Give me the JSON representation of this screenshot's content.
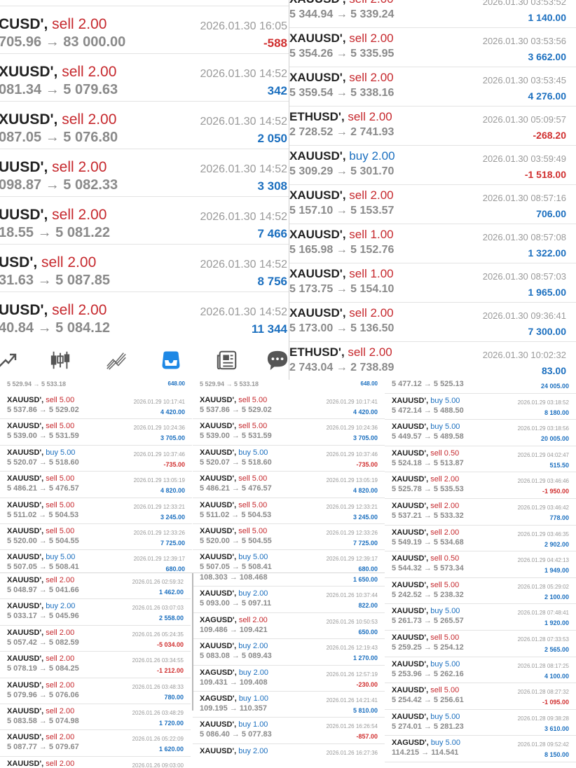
{
  "top_left_panel": {
    "rows": [
      {
        "symbol": "CUSD'",
        "side": "sell",
        "volume": "2.00",
        "prices": "705.96 → 83 000.00",
        "datetime": "2026.01.30 16:05",
        "profit": "-588"
      },
      {
        "symbol": "XUUSD'",
        "side": "sell",
        "volume": "2.00",
        "prices": "081.34 → 5 079.63",
        "datetime": "2026.01.30 14:52",
        "profit": "342"
      },
      {
        "symbol": "XUUSD'",
        "side": "sell",
        "volume": "2.00",
        "prices": "087.05 → 5 076.80",
        "datetime": "2026.01.30 14:52",
        "profit": "2 050"
      },
      {
        "symbol": "UUSD'",
        "side": "sell",
        "volume": "2.00",
        "prices": "098.87 → 5 082.33",
        "datetime": "2026.01.30 14:52",
        "profit": "3 308"
      },
      {
        "symbol": "UUSD'",
        "side": "sell",
        "volume": "2.00",
        "prices": "18.55 → 5 081.22",
        "datetime": "2026.01.30 14:52",
        "profit": "7 466"
      },
      {
        "symbol": "USD'",
        "side": "sell",
        "volume": "2.00",
        "prices": "31.63 → 5 087.85",
        "datetime": "2026.01.30 14:52",
        "profit": "8 756"
      },
      {
        "symbol": "UUSD'",
        "side": "sell",
        "volume": "2.00",
        "prices": "40.84 → 5 084.12",
        "datetime": "2026.01.30 14:52",
        "profit": "11 344"
      }
    ]
  },
  "toolbar": {
    "icons": [
      "trade-icon",
      "candlestick-icon",
      "chart-line-icon",
      "history-inbox-icon",
      "news-icon",
      "chat-icon"
    ],
    "active_color": "#1e88e5"
  },
  "top_right_panel": {
    "rows": [
      {
        "symbol": "XAUUSD'",
        "side": "sell",
        "volume": "2.00",
        "prices": "5 344.94 → 5 339.24",
        "datetime": "2026.01.30 03:53:52",
        "profit": "1 140.00"
      },
      {
        "symbol": "XAUUSD'",
        "side": "sell",
        "volume": "2.00",
        "prices": "5 354.26 → 5 335.95",
        "datetime": "2026.01.30 03:53:56",
        "profit": "3 662.00"
      },
      {
        "symbol": "XAUUSD'",
        "side": "sell",
        "volume": "2.00",
        "prices": "5 359.54 → 5 338.16",
        "datetime": "2026.01.30 03:53:45",
        "profit": "4 276.00"
      },
      {
        "symbol": "ETHUSD'",
        "side": "sell",
        "volume": "2.00",
        "prices": "2 728.52 → 2 741.93",
        "datetime": "2026.01.30 05:09:57",
        "profit": "-268.20"
      },
      {
        "symbol": "XAUUSD'",
        "side": "buy",
        "volume": "2.00",
        "prices": "5 309.29 → 5 301.70",
        "datetime": "2026.01.30 03:59:49",
        "profit": "-1 518.00"
      },
      {
        "symbol": "XAUUSD'",
        "side": "sell",
        "volume": "2.00",
        "prices": "5 157.10 → 5 153.57",
        "datetime": "2026.01.30 08:57:16",
        "profit": "706.00"
      },
      {
        "symbol": "XAUUSD'",
        "side": "sell",
        "volume": "1.00",
        "prices": "5 165.98 → 5 152.76",
        "datetime": "2026.01.30 08:57:08",
        "profit": "1 322.00"
      },
      {
        "symbol": "XAUUSD'",
        "side": "sell",
        "volume": "1.00",
        "prices": "5 173.75 → 5 154.10",
        "datetime": "2026.01.30 08:57:03",
        "profit": "1 965.00"
      },
      {
        "symbol": "XAUUSD'",
        "side": "sell",
        "volume": "2.00",
        "prices": "5 173.00 → 5 136.50",
        "datetime": "2026.01.30 09:36:41",
        "profit": "7 300.00"
      },
      {
        "symbol": "ETHUSD'",
        "side": "sell",
        "volume": "2.00",
        "prices": "2 743.04 → 2 738.89",
        "datetime": "2026.01.30 10:02:32",
        "profit": "83.00"
      }
    ]
  },
  "mid_left_panel": {
    "rows": [
      {
        "symbol": "XAUUSD'",
        "side": "sell",
        "volume": "5.00",
        "prices": "5 537.86 → 5 529.02",
        "datetime": "2026.01.29 10:17:41",
        "profit": "4 420.00"
      },
      {
        "symbol": "XAUUSD'",
        "side": "sell",
        "volume": "5.00",
        "prices": "5 539.00 → 5 531.59",
        "datetime": "2026.01.29 10:24:36",
        "profit": "3 705.00"
      },
      {
        "symbol": "XAUUSD'",
        "side": "buy",
        "volume": "5.00",
        "prices": "5 520.07 → 5 518.60",
        "datetime": "2026.01.29 10:37:46",
        "profit": "-735.00"
      },
      {
        "symbol": "XAUUSD'",
        "side": "sell",
        "volume": "5.00",
        "prices": "5 486.21 → 5 476.57",
        "datetime": "2026.01.29 13:05:19",
        "profit": "4 820.00"
      },
      {
        "symbol": "XAUUSD'",
        "side": "sell",
        "volume": "5.00",
        "prices": "5 511.02 → 5 504.53",
        "datetime": "2026.01.29 12:33:21",
        "profit": "3 245.00"
      },
      {
        "symbol": "XAUUSD'",
        "side": "sell",
        "volume": "5.00",
        "prices": "5 520.00 → 5 504.55",
        "datetime": "2026.01.29 12:33:26",
        "profit": "7 725.00"
      },
      {
        "symbol": "XAUUSD'",
        "side": "buy",
        "volume": "5.00",
        "prices": "5 507.05 → 5 508.41",
        "datetime": "2026.01.29 12:39:17",
        "profit": "680.00"
      }
    ]
  },
  "mid_center_panel": {
    "rows": [
      {
        "symbol": "XAUUSD'",
        "side": "sell",
        "volume": "5.00",
        "prices": "5 537.86 → 5 529.02",
        "datetime": "2026.01.29 10:17:41",
        "profit": "4 420.00"
      },
      {
        "symbol": "XAUUSD'",
        "side": "sell",
        "volume": "5.00",
        "prices": "5 539.00 → 5 531.59",
        "datetime": "2026.01.29 10:24:36",
        "profit": "3 705.00"
      },
      {
        "symbol": "XAUUSD'",
        "side": "buy",
        "volume": "5.00",
        "prices": "5 520.07 → 5 518.60",
        "datetime": "2026.01.29 10:37:46",
        "profit": "-735.00"
      },
      {
        "symbol": "XAUUSD'",
        "side": "sell",
        "volume": "5.00",
        "prices": "5 486.21 → 5 476.57",
        "datetime": "2026.01.29 13:05:19",
        "profit": "4 820.00"
      },
      {
        "symbol": "XAUUSD'",
        "side": "sell",
        "volume": "5.00",
        "prices": "5 511.02 → 5 504.53",
        "datetime": "2026.01.29 12:33:21",
        "profit": "3 245.00"
      },
      {
        "symbol": "XAUUSD'",
        "side": "sell",
        "volume": "5.00",
        "prices": "5 520.00 → 5 504.55",
        "datetime": "2026.01.29 12:33:26",
        "profit": "7 725.00"
      },
      {
        "symbol": "XAUUSD'",
        "side": "buy",
        "volume": "5.00",
        "prices": "5 507.05 → 5 508.41",
        "datetime": "2026.01.29 12:39:17",
        "profit": "680.00"
      }
    ]
  },
  "right_panel": {
    "rows": [
      {
        "symbol": "",
        "side": "",
        "volume": "",
        "prices": "5 477.12 → 5 525.13",
        "datetime": "",
        "profit": "24 005.00"
      },
      {
        "symbol": "XAUUSD'",
        "side": "buy",
        "volume": "5.00",
        "prices": "5 472.14 → 5 488.50",
        "datetime": "2026.01.29 03:18:52",
        "profit": "8 180.00"
      },
      {
        "symbol": "XAUUSD'",
        "side": "buy",
        "volume": "5.00",
        "prices": "5 449.57 → 5 489.58",
        "datetime": "2026.01.29 03:18:56",
        "profit": "20 005.00"
      },
      {
        "symbol": "XAUUSD'",
        "side": "sell",
        "volume": "0.50",
        "prices": "5 524.18 → 5 513.87",
        "datetime": "2026.01.29 04:02:47",
        "profit": "515.50"
      },
      {
        "symbol": "XAUUSD'",
        "side": "sell",
        "volume": "2.00",
        "prices": "5 525.78 → 5 535.53",
        "datetime": "2026.01.29 03:46:46",
        "profit": "-1 950.00"
      },
      {
        "symbol": "XAUUSD'",
        "side": "sell",
        "volume": "2.00",
        "prices": "5 537.21 → 5 533.32",
        "datetime": "2026.01.29 03:46:42",
        "profit": "778.00"
      },
      {
        "symbol": "XAUUSD'",
        "side": "sell",
        "volume": "2.00",
        "prices": "5 549.19 → 5 534.68",
        "datetime": "2026.01.29 03:46:35",
        "profit": "2 902.00"
      },
      {
        "symbol": "XAUUSD'",
        "side": "sell",
        "volume": "0.50",
        "prices": "5 544.32 → 5 573.34",
        "datetime": "2026.01.29 04:42:13",
        "profit": "1 949.00"
      },
      {
        "symbol": "XAUUSD'",
        "side": "sell",
        "volume": "5.00",
        "prices": "5 242.52 → 5 238.32",
        "datetime": "2026.01.28 05:29:02",
        "profit": "2 100.00"
      },
      {
        "symbol": "XAUUSD'",
        "side": "buy",
        "volume": "5.00",
        "prices": "5 261.73 → 5 265.57",
        "datetime": "2026.01.28 07:48:41",
        "profit": "1 920.00"
      },
      {
        "symbol": "XAUUSD'",
        "side": "sell",
        "volume": "5.00",
        "prices": "5 259.25 → 5 254.12",
        "datetime": "2026.01.28 07:33:53",
        "profit": "2 565.00"
      },
      {
        "symbol": "XAUUSD'",
        "side": "buy",
        "volume": "5.00",
        "prices": "5 253.96 → 5 262.16",
        "datetime": "2026.01.28 08:17:25",
        "profit": "4 100.00"
      },
      {
        "symbol": "XAUUSD'",
        "side": "sell",
        "volume": "5.00",
        "prices": "5 254.42 → 5 256.61",
        "datetime": "2026.01.28 08:27:32",
        "profit": "-1 095.00"
      },
      {
        "symbol": "XAUUSD'",
        "side": "buy",
        "volume": "5.00",
        "prices": "5 274.01 → 5 281.23",
        "datetime": "2026.01.28 09:38:28",
        "profit": "3 610.00"
      },
      {
        "symbol": "XAGUSD'",
        "side": "buy",
        "volume": "5.00",
        "prices": "114.215 → 114.541",
        "datetime": "2026.01.28 09:52:42",
        "profit": "8 150.00"
      }
    ]
  },
  "bottom_left_panel": {
    "rows": [
      {
        "symbol": "XAUUSD'",
        "side": "sell",
        "volume": "2.00",
        "prices": "5 048.97 → 5 041.66",
        "datetime": "2026.01.26 02:59:32",
        "profit": "1 462.00"
      },
      {
        "symbol": "XAUUSD'",
        "side": "buy",
        "volume": "2.00",
        "prices": "5 033.17 → 5 045.96",
        "datetime": "2026.01.26 03:07:03",
        "profit": "2 558.00"
      },
      {
        "symbol": "XAUUSD'",
        "side": "sell",
        "volume": "2.00",
        "prices": "5 057.42 → 5 082.59",
        "datetime": "2026.01.26 05:24:35",
        "profit": "-5 034.00"
      },
      {
        "symbol": "XAUUSD'",
        "side": "sell",
        "volume": "2.00",
        "prices": "5 078.19 → 5 084.25",
        "datetime": "2026.01.26 03:34:55",
        "profit": "-1 212.00"
      },
      {
        "symbol": "XAUUSD'",
        "side": "sell",
        "volume": "2.00",
        "prices": "5 079.96 → 5 076.06",
        "datetime": "2026.01.26 03:48:33",
        "profit": "780.00"
      },
      {
        "symbol": "XAUUSD'",
        "side": "sell",
        "volume": "2.00",
        "prices": "5 083.58 → 5 074.98",
        "datetime": "2026.01.26 03:48:29",
        "profit": "1 720.00"
      },
      {
        "symbol": "XAUUSD'",
        "side": "sell",
        "volume": "2.00",
        "prices": "5 087.77 → 5 079.67",
        "datetime": "2026.01.26 05:22:09",
        "profit": "1 620.00"
      },
      {
        "symbol": "XAUUSD'",
        "side": "sell",
        "volume": "2.00",
        "prices": "",
        "datetime": "2026.01.26 09:03:00",
        "profit": ""
      }
    ]
  },
  "bottom_center_panel": {
    "rows": [
      {
        "symbol": "",
        "side": "",
        "volume": "",
        "prices": "108.303 → 108.468",
        "datetime": "",
        "profit": "1 650.00"
      },
      {
        "symbol": "XAUUSD'",
        "side": "buy",
        "volume": "2.00",
        "prices": "5 093.00 → 5 097.11",
        "datetime": "2026.01.26 10:37:44",
        "profit": "822.00"
      },
      {
        "symbol": "XAGUSD'",
        "side": "sell",
        "volume": "2.00",
        "prices": "109.486 → 109.421",
        "datetime": "2026.01.26 10:50:53",
        "profit": "650.00"
      },
      {
        "symbol": "XAUUSD'",
        "side": "buy",
        "volume": "2.00",
        "prices": "5 083.08 → 5 089.43",
        "datetime": "2026.01.26 12:19:43",
        "profit": "1 270.00"
      },
      {
        "symbol": "XAGUSD'",
        "side": "buy",
        "volume": "2.00",
        "prices": "109.431 → 109.408",
        "datetime": "2026.01.26 12:57:19",
        "profit": "-230.00"
      },
      {
        "symbol": "XAGUSD'",
        "side": "buy",
        "volume": "1.00",
        "prices": "109.195 → 110.357",
        "datetime": "2026.01.26 14:21:41",
        "profit": "5 810.00"
      },
      {
        "symbol": "XAUUSD'",
        "side": "buy",
        "volume": "1.00",
        "prices": "5 086.40 → 5 077.83",
        "datetime": "2026.01.26 16:26:54",
        "profit": "-857.00"
      },
      {
        "symbol": "XAUUSD'",
        "side": "buy",
        "volume": "2.00",
        "prices": "",
        "datetime": "2026.01.26 16:27:36",
        "profit": ""
      }
    ]
  }
}
